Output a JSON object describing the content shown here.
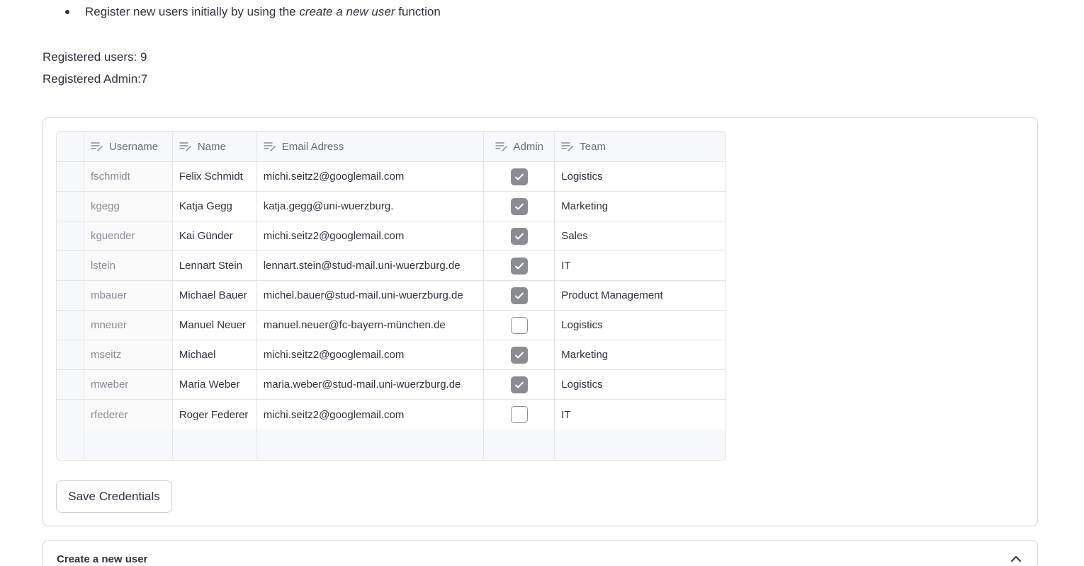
{
  "instructions": {
    "bullet_prefix": "Register new users initially by using the ",
    "bullet_emphasis": "create a new user",
    "bullet_suffix": " function"
  },
  "stats": {
    "registered_users": "Registered users: 9",
    "registered_admin": "Registered Admin:7"
  },
  "table": {
    "columns": [
      "Username",
      "Name",
      "Email Adress",
      "Admin",
      "Team"
    ],
    "rows": [
      {
        "username": "fschmidt",
        "name": "Felix Schmidt",
        "email": "michi.seitz2@googlemail.com",
        "admin": true,
        "team": "Logistics"
      },
      {
        "username": "kgegg",
        "name": "Katja Gegg",
        "email": "katja.gegg@uni-wuerzburg.",
        "admin": true,
        "team": "Marketing"
      },
      {
        "username": "kguender",
        "name": "Kai Günder",
        "email": "michi.seitz2@googlemail.com",
        "admin": true,
        "team": "Sales"
      },
      {
        "username": "lstein",
        "name": "Lennart Stein",
        "email": "lennart.stein@stud-mail.uni-wuerzburg.de",
        "admin": true,
        "team": "IT"
      },
      {
        "username": "mbauer",
        "name": "Michael Bauer",
        "email": "michel.bauer@stud-mail.uni-wuerzburg.de",
        "admin": true,
        "team": "Product Management"
      },
      {
        "username": "mneuer",
        "name": "Manuel Neuer",
        "email": "manuel.neuer@fc-bayern-münchen.de",
        "admin": false,
        "team": "Logistics"
      },
      {
        "username": "mseitz",
        "name": "Michael",
        "email": "michi.seitz2@googlemail.com",
        "admin": true,
        "team": "Marketing"
      },
      {
        "username": "mweber",
        "name": "Maria Weber",
        "email": "maria.weber@stud-mail.uni-wuerzburg.de",
        "admin": true,
        "team": "Logistics"
      },
      {
        "username": "rfederer",
        "name": "Roger Federer",
        "email": "michi.seitz2@googlemail.com",
        "admin": false,
        "team": "IT"
      }
    ]
  },
  "buttons": {
    "save_label": "Save Credentials"
  },
  "expander": {
    "title": "Create a new user",
    "icon": "chevron-up-icon"
  },
  "colors": {
    "text": "#31333f",
    "header_bg": "#f7f8fa",
    "checkbox_checked": "#8a8c92",
    "border": "#d6d6d9"
  }
}
